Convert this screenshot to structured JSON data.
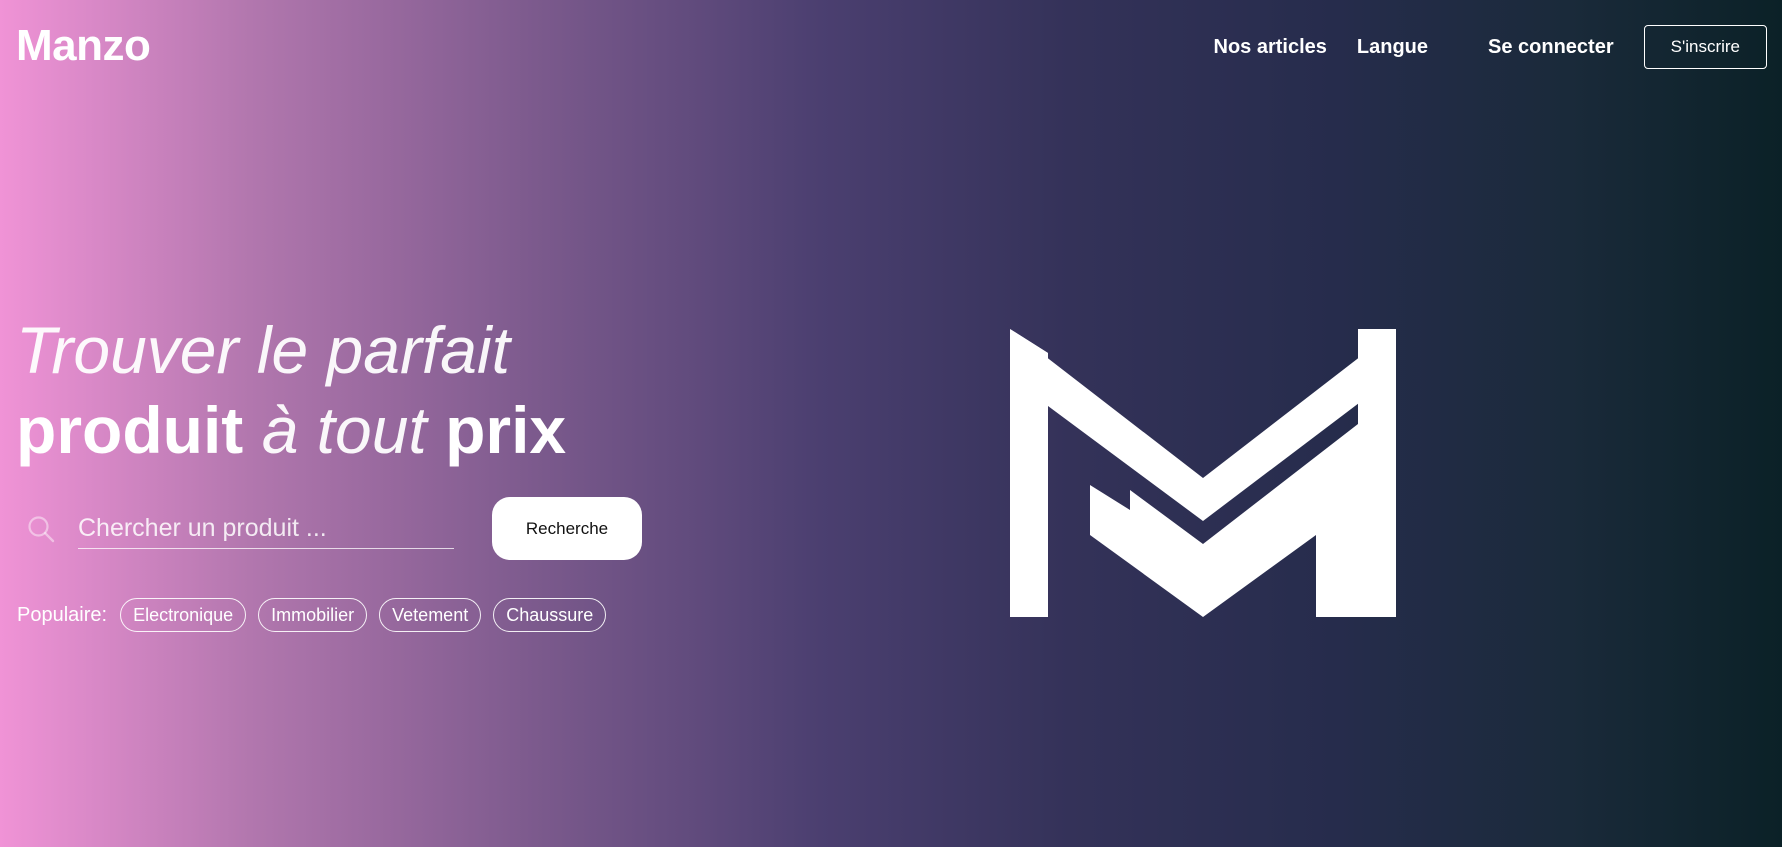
{
  "header": {
    "logo": "Manzo",
    "nav": {
      "articles": "Nos articles",
      "language": "Langue",
      "login": "Se connecter",
      "signup": "S'inscrire"
    }
  },
  "hero": {
    "title_part1": "Trouver le parfait",
    "title_word_produit": "produit",
    "title_word_a_tout": "à tout",
    "title_word_prix": "prix"
  },
  "search": {
    "placeholder": "Chercher un produit ...",
    "value": "",
    "button_label": "Recherche",
    "icon": "search-icon"
  },
  "popular": {
    "label": "Populaire:",
    "tags": [
      "Electronique",
      "Immobilier",
      "Vetement",
      "Chaussure"
    ]
  },
  "brand_mark": {
    "icon": "manzo-m-logo"
  },
  "colors": {
    "gradient_start": "#f093d6",
    "gradient_mid": "#4b3f70",
    "gradient_end": "#0b2127",
    "text": "#ffffff",
    "button_bg": "#ffffff",
    "button_text": "#111111"
  }
}
